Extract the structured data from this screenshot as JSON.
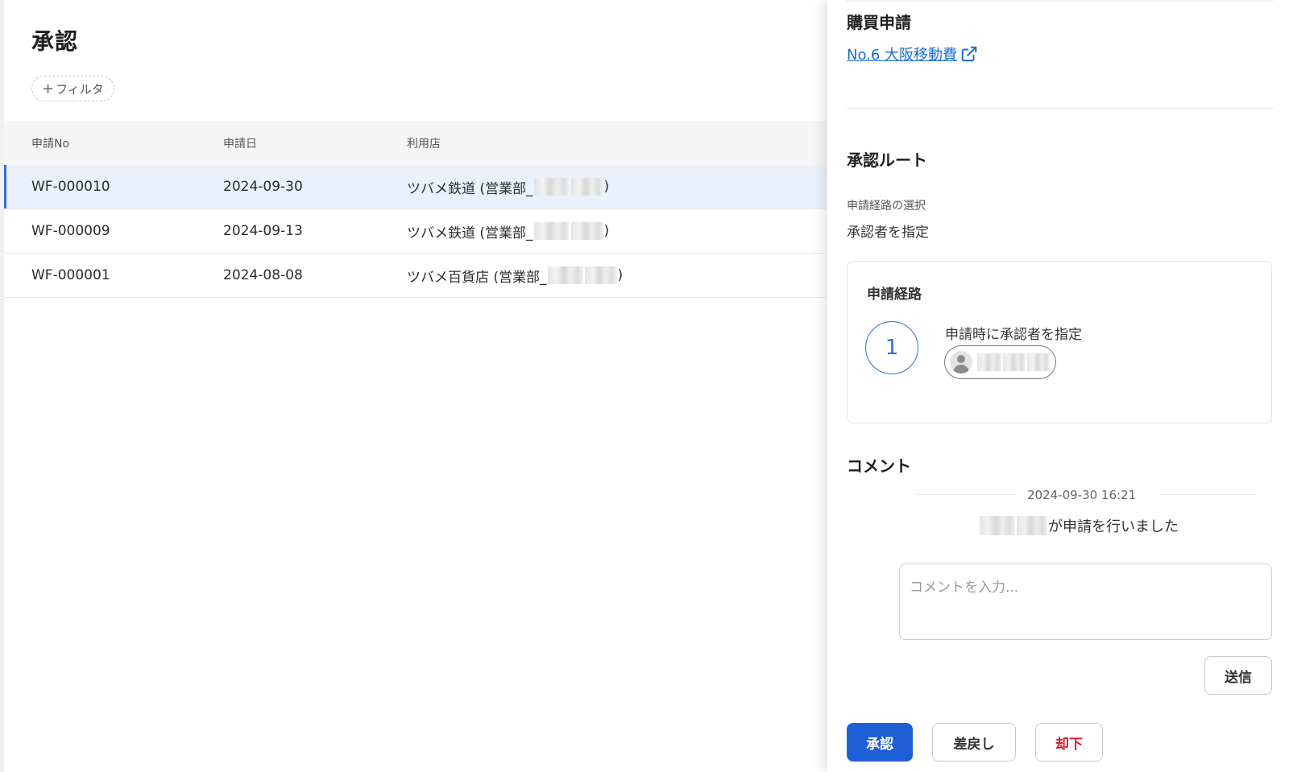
{
  "page": {
    "title": "承認"
  },
  "filter": {
    "label": "フィルタ",
    "plus": "+"
  },
  "table": {
    "columns": [
      "申請No",
      "申請日",
      "利用店"
    ],
    "rows": [
      {
        "no": "WF-000010",
        "date": "2024-09-30",
        "store_prefix": "ツバメ鉄道 (営業部_",
        "store_suffix": ")"
      },
      {
        "no": "WF-000009",
        "date": "2024-09-13",
        "store_prefix": "ツバメ鉄道 (営業部_",
        "store_suffix": ")"
      },
      {
        "no": "WF-000001",
        "date": "2024-08-08",
        "store_prefix": "ツバメ百貨店 (営業部_",
        "store_suffix": ")"
      }
    ]
  },
  "panel": {
    "purchase_title": "購買申請",
    "purchase_link": "No.6 大阪移動費",
    "route_title": "承認ルート",
    "route_select_label": "申請経路の選択",
    "route_select_value": "承認者を指定",
    "route_card": {
      "title": "申請経路",
      "step_number": "1",
      "step_label": "申請時に承認者を指定"
    },
    "comment_title": "コメント",
    "comment_timestamp": "2024-09-30 16:21",
    "comment_message": "が申請を行いました",
    "comment_placeholder": "コメントを入力...",
    "send_label": "送信",
    "approve_label": "承認",
    "return_label": "差戻し",
    "reject_label": "却下"
  },
  "icons": {
    "external_link": "external-link-icon",
    "avatar": "avatar-icon",
    "add": "plus-icon"
  },
  "colors": {
    "accent": "#1f5fd6",
    "link": "#1a6dd4",
    "danger": "#d0202a",
    "selected_row": "#eaf1fd"
  }
}
